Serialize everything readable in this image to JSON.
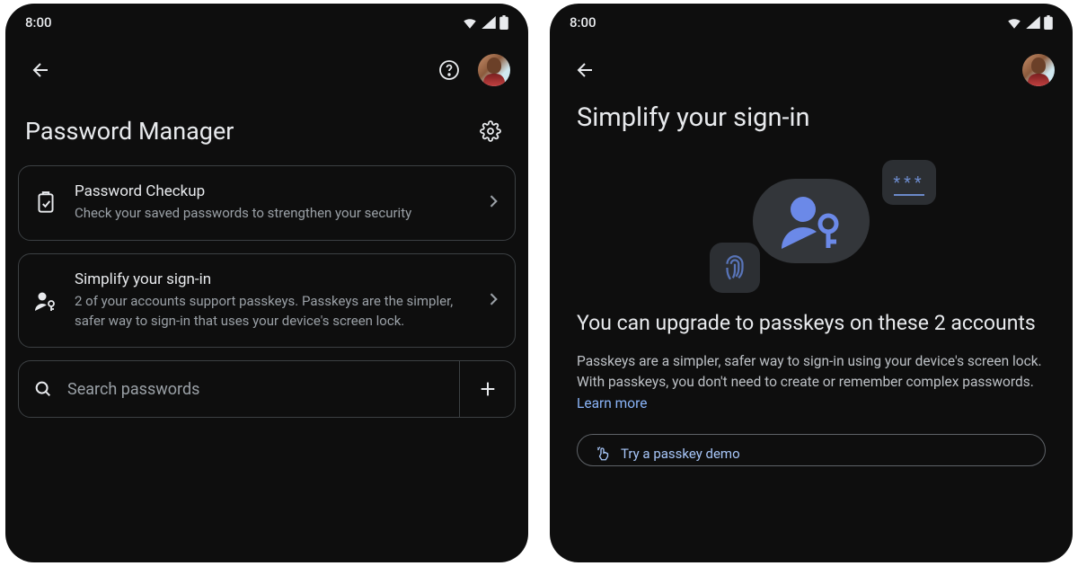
{
  "status": {
    "time": "8:00"
  },
  "left": {
    "title": "Password Manager",
    "cards": [
      {
        "title": "Password Checkup",
        "desc": "Check your saved passwords to strengthen your security"
      },
      {
        "title": "Simplify your sign-in",
        "desc": "2 of your accounts support passkeys. Passkeys are the simpler, safer way to sign-in that uses your device's screen lock."
      }
    ],
    "search_placeholder": "Search passwords"
  },
  "right": {
    "hero": "Simplify your sign-in",
    "password_mask": "***",
    "subheading": "You can upgrade to passkeys on these 2 accounts",
    "desc": "Passkeys are a simpler, safer way to sign-in using your device's screen lock. With passkeys, you don't need to create or remember complex passwords. ",
    "learn": "Learn more",
    "demo_label": "Try a passkey demo"
  }
}
